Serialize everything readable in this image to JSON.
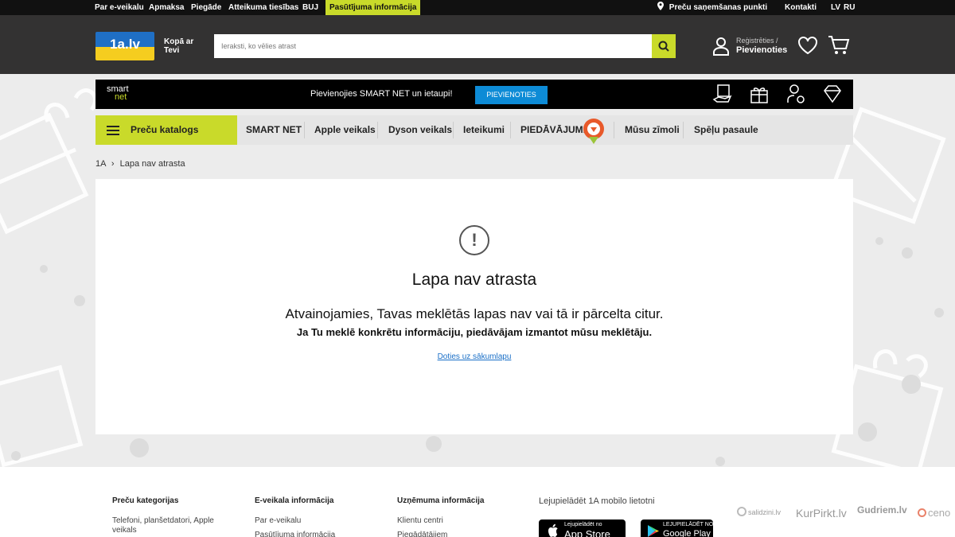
{
  "topbar": {
    "links": [
      "Par e-veikalu",
      "Apmaksa",
      "Piegāde",
      "Atteikuma tiesības",
      "BUJ",
      "Pasūtījuma informācija"
    ],
    "pickup": "Preču saņemšanas punkti",
    "contacts": "Kontakti",
    "lang_lv": "LV",
    "lang_ru": "RU"
  },
  "header": {
    "logo": "1a.lv",
    "tagline": "Kopā ar Tevi",
    "search_placeholder": "Ieraksti, ko vēlies atrast",
    "register": "Reģistrēties /",
    "login": "Pievienoties"
  },
  "smartnet": {
    "logo_line1": "smart",
    "logo_line2": "net",
    "text": "Pievienojies SMART NET un ietaupi!",
    "button": "PIEVIENOTIES"
  },
  "catnav": {
    "catalog": "Preču katalogs",
    "items": [
      "SMART NET",
      "Apple veikals",
      "Dyson veikals",
      "Ieteikumi",
      "PIEDĀVĀJUMI",
      "Mūsu zīmoli",
      "Spēļu pasaule"
    ]
  },
  "breadcrumb": {
    "home": "1A",
    "current": "Lapa nav atrasta"
  },
  "notfound": {
    "title": "Lapa nav atrasta",
    "subtitle": "Atvainojamies, Tavas meklētās lapas nav vai tā ir pārcelta citur.",
    "hint": "Ja Tu meklē konkrētu informāciju, piedāvājam izmantot mūsu meklētāju.",
    "link": "Doties uz sākumlapu"
  },
  "footer": {
    "col1_title": "Preču kategorijas",
    "col1_items": [
      "Telefoni, planšetdatori, Apple veikals"
    ],
    "col2_title": "E-veikala informācija",
    "col2_items": [
      "Par e-veikalu",
      "Pasūtījuma informācija"
    ],
    "col3_title": "Uzņēmuma informācija",
    "col3_items": [
      "Klientu centri",
      "Piegādātājiem"
    ],
    "app_title": "Lejupielādēt 1A mobilo lietotni",
    "appstore_small": "Lejupielādēt no",
    "appstore_big": "App Store",
    "gplay_small": "LEJUPIELĀDĒT NO",
    "gplay_big": "Google Play",
    "partners": [
      "salidzini.lv",
      "KurPirkt.lv",
      "Gudriem.lv",
      "ceno"
    ]
  },
  "colors": {
    "accent": "#c9da2a",
    "header_bg": "#333232",
    "topbar_bg": "#111111",
    "smartnet_button": "#0d8bd6",
    "link": "#1a6fc7"
  }
}
